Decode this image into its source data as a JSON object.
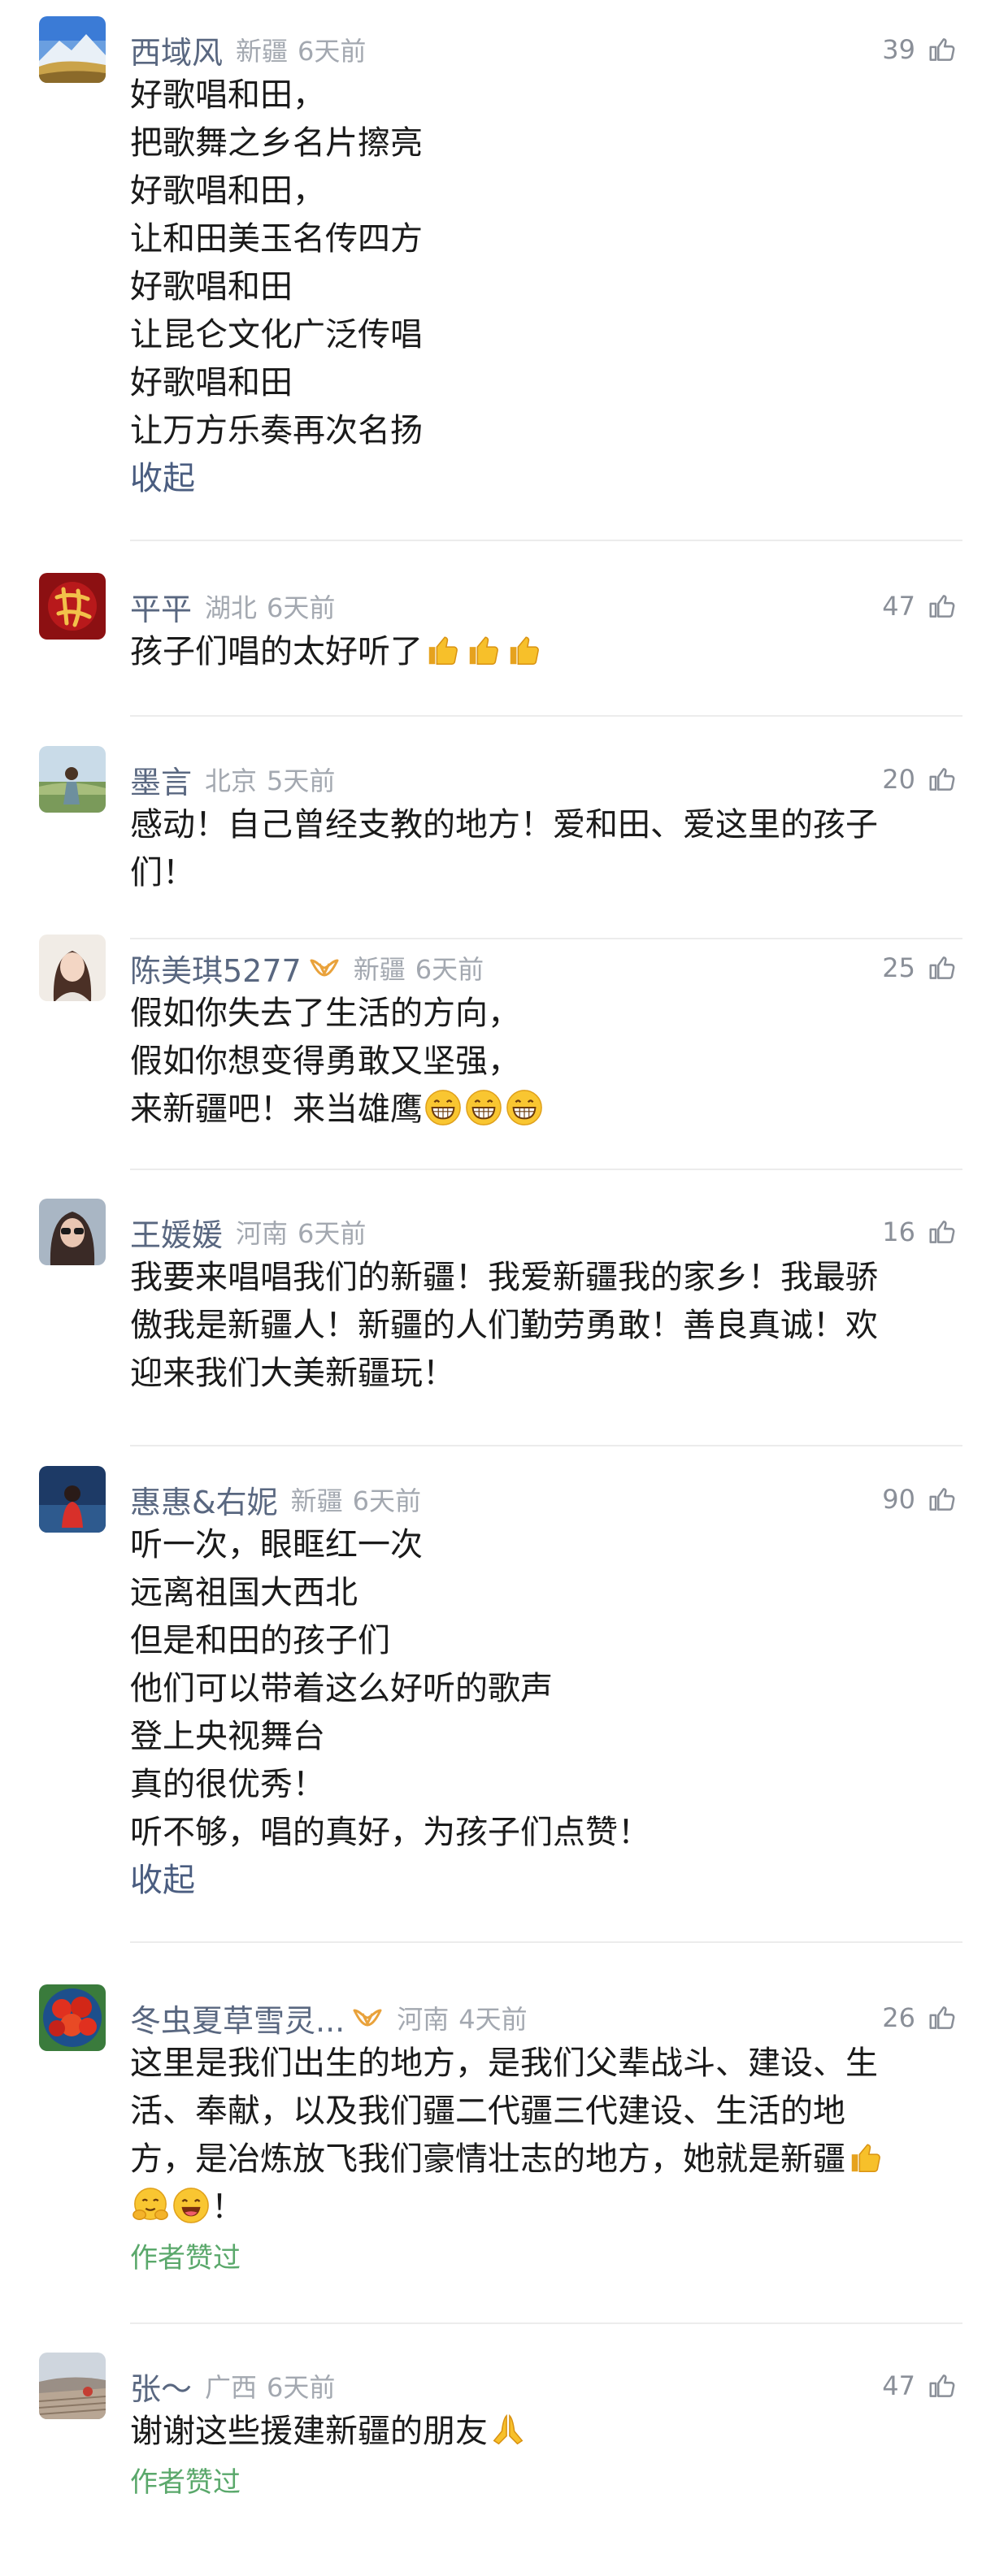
{
  "comments": [
    {
      "name": "西域风",
      "location": "新疆",
      "time": "6天前",
      "likes": "39",
      "avatar": "mountain-landscape-avatar",
      "lines": [
        "好歌唱和田，",
        "把歌舞之乡名片擦亮",
        "好歌唱和田，",
        "让和田美玉名传四方",
        "好歌唱和田",
        "让昆仑文化广泛传唱",
        "好歌唱和田",
        "让万方乐奏再次名扬"
      ],
      "collapse": "收起"
    },
    {
      "name": "平平",
      "location": "湖北",
      "time": "6天前",
      "likes": "47",
      "avatar": "red-calligraphy-avatar",
      "lines": [
        "孩子们唱的太好听了"
      ],
      "emoji_after": [
        "thumbs-up",
        "thumbs-up",
        "thumbs-up"
      ]
    },
    {
      "name": "墨言",
      "location": "北京",
      "time": "5天前",
      "likes": "20",
      "avatar": "person-outdoor-avatar",
      "lines": [
        "感动！自己曾经支教的地方！爱和田、爱这里的孩子",
        "们！"
      ]
    },
    {
      "name": "陈美琪5277",
      "location": "新疆",
      "time": "6天前",
      "likes": "25",
      "avatar": "woman-portrait-avatar",
      "badge": "vip-badge-icon",
      "lines": [
        "假如你失去了生活的方向，",
        "假如你想变得勇敢又坚强，",
        "来新疆吧！来当雄鹰"
      ],
      "emoji_after": [
        "grin",
        "grin",
        "grin"
      ]
    },
    {
      "name": "王媛媛",
      "location": "河南",
      "time": "6天前",
      "likes": "16",
      "avatar": "woman-sunglasses-avatar",
      "lines": [
        "我要来唱唱我们的新疆！我爱新疆我的家乡！我最骄",
        "傲我是新疆人！新疆的人们勤劳勇敢！善良真诚！欢",
        "迎来我们大美新疆玩！"
      ]
    },
    {
      "name": "惠惠&右妮",
      "location": "新疆",
      "time": "6天前",
      "likes": "90",
      "avatar": "woman-red-scarf-avatar",
      "lines": [
        "听一次，眼眶红一次",
        "远离祖国大西北",
        "但是和田的孩子们",
        "他们可以带着这么好听的歌声",
        "登上央视舞台",
        "真的很优秀！",
        "听不够，唱的真好，为孩子们点赞！"
      ],
      "collapse": "收起"
    },
    {
      "name": "冬虫夏草雪灵...",
      "location": "河南",
      "time": "4天前",
      "likes": "26",
      "avatar": "red-flowers-avatar",
      "badge": "vip-badge-icon",
      "lines": [
        "这里是我们出生的地方，是我们父辈战斗、建设、生",
        "活、奉献，以及我们疆二代疆三代建设、生活的地",
        "方，是冶炼放飞我们豪情壮志的地方，她就是新疆"
      ],
      "emoji_after": [
        "thumbs-up"
      ],
      "emoji_line": [
        "hug",
        "smile"
      ],
      "tail": "！",
      "author_liked": "作者赞过"
    },
    {
      "name": "张～",
      "location": "广西",
      "time": "6天前",
      "likes": "47",
      "avatar": "landscape-field-avatar",
      "lines": [
        "谢谢这些援建新疆的朋友"
      ],
      "emoji_after": [
        "pray"
      ],
      "author_liked": "作者赞过"
    }
  ],
  "colors": {
    "name": "#596780",
    "meta": "#a3a8b0",
    "collapse": "#4a5d80",
    "author_liked": "#5aa86b",
    "divider": "#ececec"
  }
}
